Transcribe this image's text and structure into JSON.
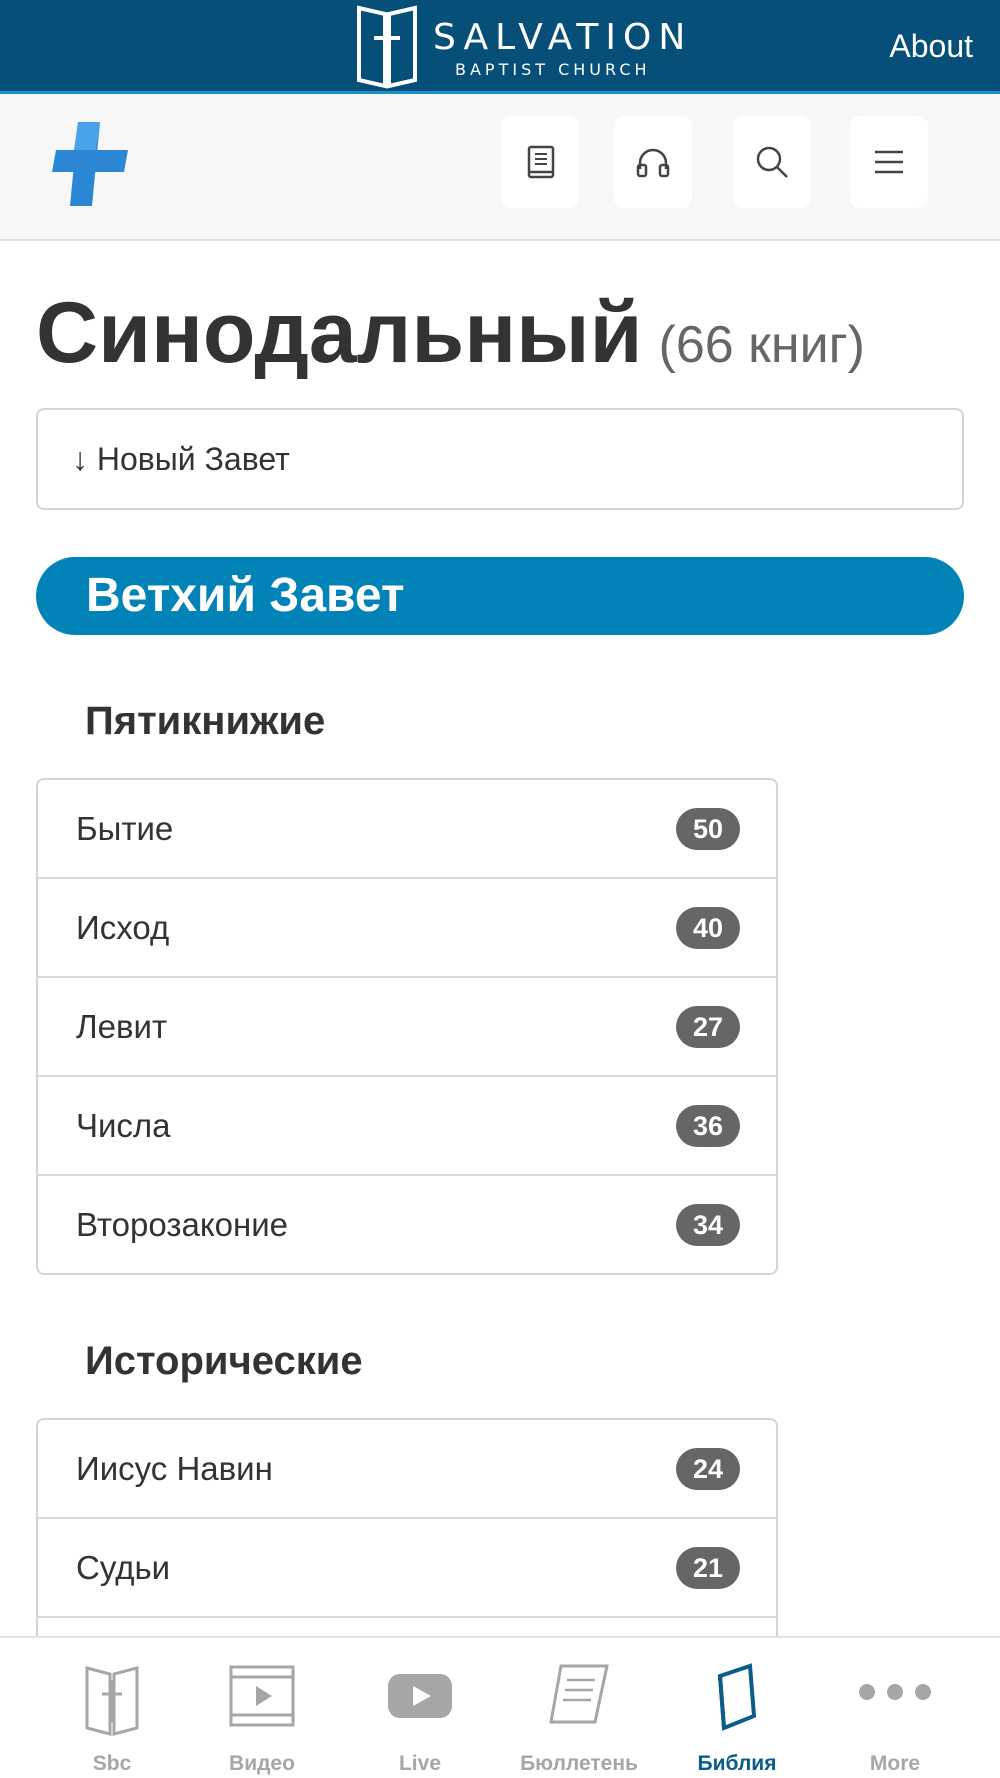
{
  "brand": {
    "name_line1": "SALVATION",
    "name_line2": "BAPTIST CHURCH"
  },
  "topnav": {
    "about": "About"
  },
  "header": {
    "buttons": [
      "book-icon",
      "headphones-icon",
      "search-icon",
      "menu-icon"
    ]
  },
  "page": {
    "title": "Синодальный",
    "count": "(66 книг)",
    "jump_link": "↓ Новый Завет"
  },
  "testament": {
    "label": "Ветхий Завет"
  },
  "sections": [
    {
      "heading": "Пятикнижие",
      "books": [
        {
          "name": "Бытие",
          "chapters": "50"
        },
        {
          "name": "Исход",
          "chapters": "40"
        },
        {
          "name": "Левит",
          "chapters": "27"
        },
        {
          "name": "Числа",
          "chapters": "36"
        },
        {
          "name": "Второзаконие",
          "chapters": "34"
        }
      ]
    },
    {
      "heading": "Исторические",
      "books": [
        {
          "name": "Иисус Навин",
          "chapters": "24"
        },
        {
          "name": "Судьи",
          "chapters": "21"
        }
      ]
    }
  ],
  "tabbar": {
    "active": "Библия",
    "tabs": [
      {
        "label": "Sbc",
        "icon": "open-book-cross-icon"
      },
      {
        "label": "Видео",
        "icon": "film-icon"
      },
      {
        "label": "Live",
        "icon": "youtube-play-icon"
      },
      {
        "label": "Бюллетень",
        "icon": "scroll-icon"
      },
      {
        "label": "Библия",
        "icon": "bible-icon"
      },
      {
        "label": "More",
        "icon": "more-dots-icon"
      }
    ]
  },
  "colors": {
    "brand_bar": "#064f78",
    "accent": "#0283b8",
    "badge": "#666666",
    "active_tab": "#0a5c8a"
  }
}
